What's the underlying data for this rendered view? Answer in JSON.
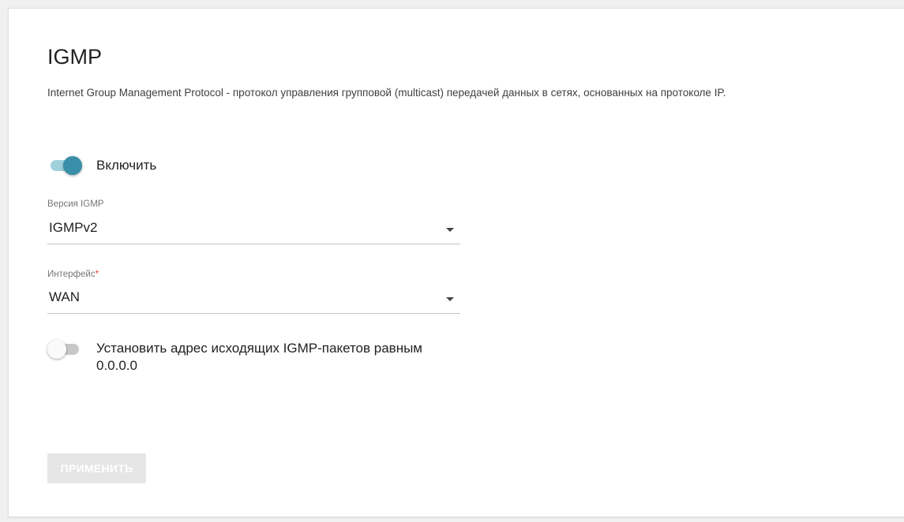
{
  "page": {
    "title": "IGMP",
    "description": "Internet Group Management Protocol - протокол управления групповой (multicast) передачей данных в сетях, основанных на протоколе IP."
  },
  "enable_toggle": {
    "label": "Включить",
    "state": true
  },
  "igmp_version": {
    "label": "Версия IGMP",
    "value": "IGMPv2"
  },
  "interface": {
    "label": "Интерфейс",
    "required_mark": "*",
    "value": "WAN"
  },
  "zero_source_toggle": {
    "label": "Установить адрес исходящих IGMP-пакетов равным 0.0.0.0",
    "state": false
  },
  "apply_button": {
    "label": "ПРИМЕНИТЬ",
    "enabled": false
  },
  "colors": {
    "accent": "#3a8fa8",
    "accent_track": "#9fd0dc",
    "required": "#e53935",
    "disabled_button": "#e6e6e6"
  }
}
